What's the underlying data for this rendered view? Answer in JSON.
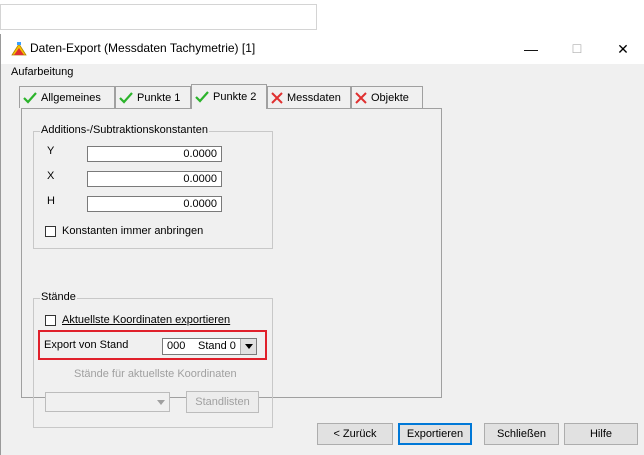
{
  "window": {
    "title": "Daten-Export (Messdaten Tachymetrie) [1]",
    "minimize_glyph": "—",
    "maximize_glyph": "☐",
    "close_glyph": "✕"
  },
  "menu": {
    "items": [
      "Aufarbeitung"
    ]
  },
  "tabs": [
    {
      "label": "Allgemeines",
      "status_icon": "check-icon",
      "status_color": "#2bb32b"
    },
    {
      "label": "Punkte 1",
      "status_icon": "check-icon",
      "status_color": "#2bb32b"
    },
    {
      "label": "Punkte 2",
      "status_icon": "check-icon",
      "status_color": "#2bb32b",
      "active": true
    },
    {
      "label": "Messdaten",
      "status_icon": "cross-icon",
      "status_color": "#e03030"
    },
    {
      "label": "Objekte",
      "status_icon": "cross-icon",
      "status_color": "#e03030"
    }
  ],
  "constants_group": {
    "title": "Additions-/Subtraktionskonstanten",
    "rows": [
      {
        "label": "Y",
        "value": "0.0000"
      },
      {
        "label": "X",
        "value": "0.0000"
      },
      {
        "label": "H",
        "value": "0.0000"
      }
    ],
    "checkbox_label": "Konstanten immer anbringen",
    "checkbox_checked": false
  },
  "stands_group": {
    "title": "Stände",
    "checkbox_label": "Aktuellste Koordinaten exportieren",
    "checkbox_checked": false,
    "export_label": "Export von Stand",
    "stand_number": "000",
    "stand_name": "Stand 0",
    "highlight_color": "#e0202b",
    "current_coords_label": "Stände für aktuellste Koordinaten",
    "current_coords_value": "",
    "standlisten_button": "Standlisten"
  },
  "footer": {
    "back": "< Zurück",
    "export": "Exportieren",
    "close": "Schließen",
    "help": "Hilfe"
  }
}
